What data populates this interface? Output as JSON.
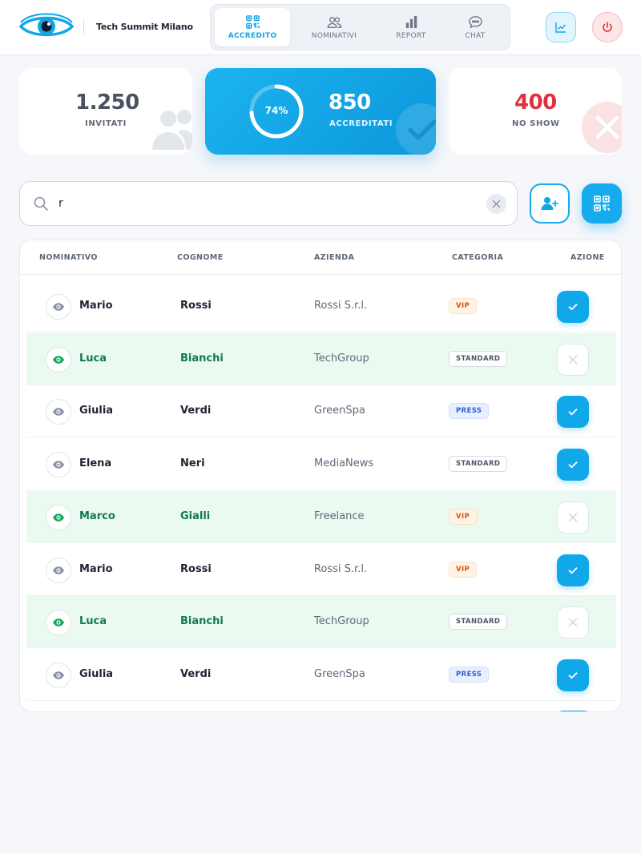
{
  "header": {
    "brand": "Tech Summit Milano",
    "logo_icon": "eye-logo-icon",
    "tabs": [
      {
        "label": "ACCREDITO",
        "icon": "qr-code-icon",
        "active": true
      },
      {
        "label": "NOMINATIVI",
        "icon": "users-icon",
        "active": false
      },
      {
        "label": "REPORT",
        "icon": "bar-chart-icon",
        "active": false
      },
      {
        "label": "CHAT",
        "icon": "chat-icon",
        "active": false
      }
    ],
    "actions": [
      {
        "name": "stats",
        "icon": "trend-chart-icon"
      },
      {
        "name": "logout",
        "icon": "power-icon"
      }
    ]
  },
  "stats": {
    "invitati": {
      "value": "1.250",
      "label": "INVITATI"
    },
    "accreditati": {
      "value": "850",
      "label": "ACCREDITATI",
      "percent": "74%",
      "progress": 0.74
    },
    "no_show": {
      "value": "400",
      "label": "NO SHOW"
    }
  },
  "search": {
    "value": "r",
    "placeholder": ""
  },
  "table": {
    "columns": [
      "NOMINATIVO",
      "COGNOME",
      "AZIENDA",
      "CATEGORIA",
      "AZIONE"
    ],
    "rows": [
      {
        "nome": "Mario",
        "cognome": "Rossi",
        "azienda": "Rossi S.r.l.",
        "categoria": "VIP",
        "accreditato": true
      },
      {
        "nome": "Luca",
        "cognome": "Bianchi",
        "azienda": "TechGroup",
        "categoria": "STANDARD",
        "accreditato": false
      },
      {
        "nome": "Giulia",
        "cognome": "Verdi",
        "azienda": "GreenSpa",
        "categoria": "PRESS",
        "accreditato": true
      },
      {
        "nome": "Elena",
        "cognome": "Neri",
        "azienda": "MediaNews",
        "categoria": "STANDARD",
        "accreditato": true
      },
      {
        "nome": "Marco",
        "cognome": "Gialli",
        "azienda": "Freelance",
        "categoria": "VIP",
        "accreditato": false
      },
      {
        "nome": "Mario",
        "cognome": "Rossi",
        "azienda": "Rossi S.r.l.",
        "categoria": "VIP",
        "accreditato": true
      },
      {
        "nome": "Luca",
        "cognome": "Bianchi",
        "azienda": "TechGroup",
        "categoria": "STANDARD",
        "accreditato": false
      },
      {
        "nome": "Giulia",
        "cognome": "Verdi",
        "azienda": "GreenSpa",
        "categoria": "PRESS",
        "accreditato": true
      }
    ]
  },
  "colors": {
    "accent": "#12a6e6",
    "danger": "#e0323e",
    "success": "#137a4b",
    "row_highlight": "#eafaf0"
  }
}
